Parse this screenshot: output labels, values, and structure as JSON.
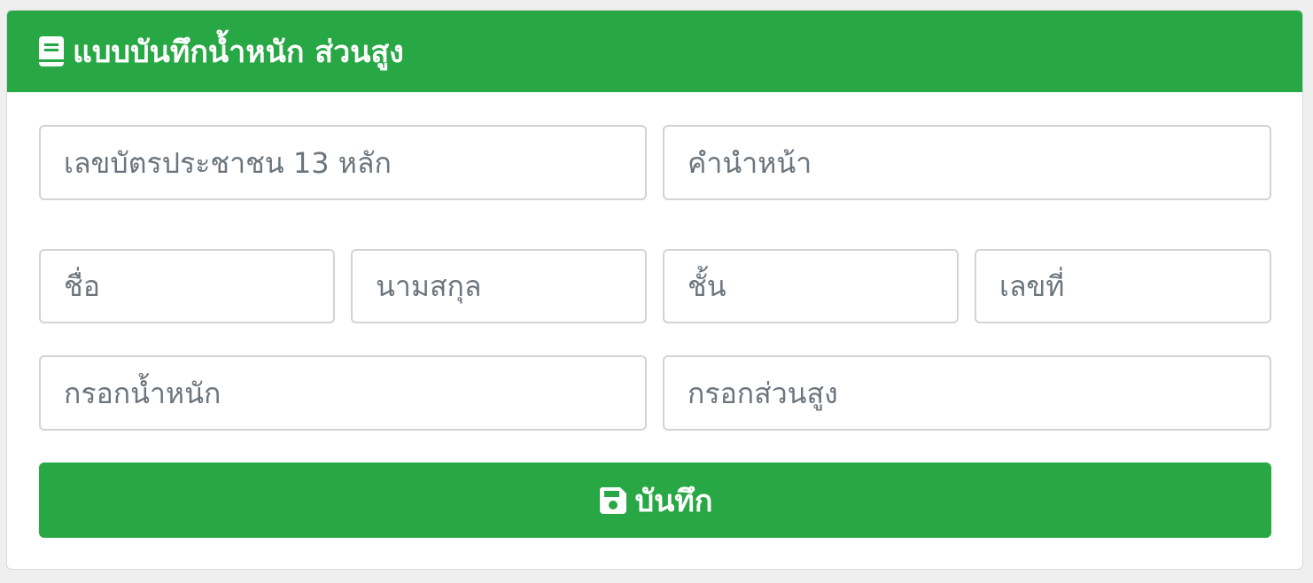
{
  "header": {
    "title": "แบบบันทึกน้ำหนัก ส่วนสูง",
    "icon": "book-icon"
  },
  "form": {
    "citizen_id": {
      "placeholder": "เลขบัตรประชาชน 13 หลัก",
      "value": ""
    },
    "prefix": {
      "placeholder": "คำนำหน้า",
      "value": ""
    },
    "first_name": {
      "placeholder": "ชื่อ",
      "value": ""
    },
    "last_name": {
      "placeholder": "นามสกุล",
      "value": ""
    },
    "class_level": {
      "placeholder": "ชั้น",
      "value": ""
    },
    "student_number": {
      "placeholder": "เลขที่",
      "value": ""
    },
    "weight": {
      "placeholder": "กรอกน้ำหนัก",
      "value": ""
    },
    "height": {
      "placeholder": "กรอกส่วนสูง",
      "value": ""
    }
  },
  "save_button": {
    "label": "บันทึก",
    "icon": "save-icon"
  },
  "colors": {
    "accent": "#28a745",
    "field_border": "#d2d3d8",
    "placeholder": "#6c757d"
  }
}
